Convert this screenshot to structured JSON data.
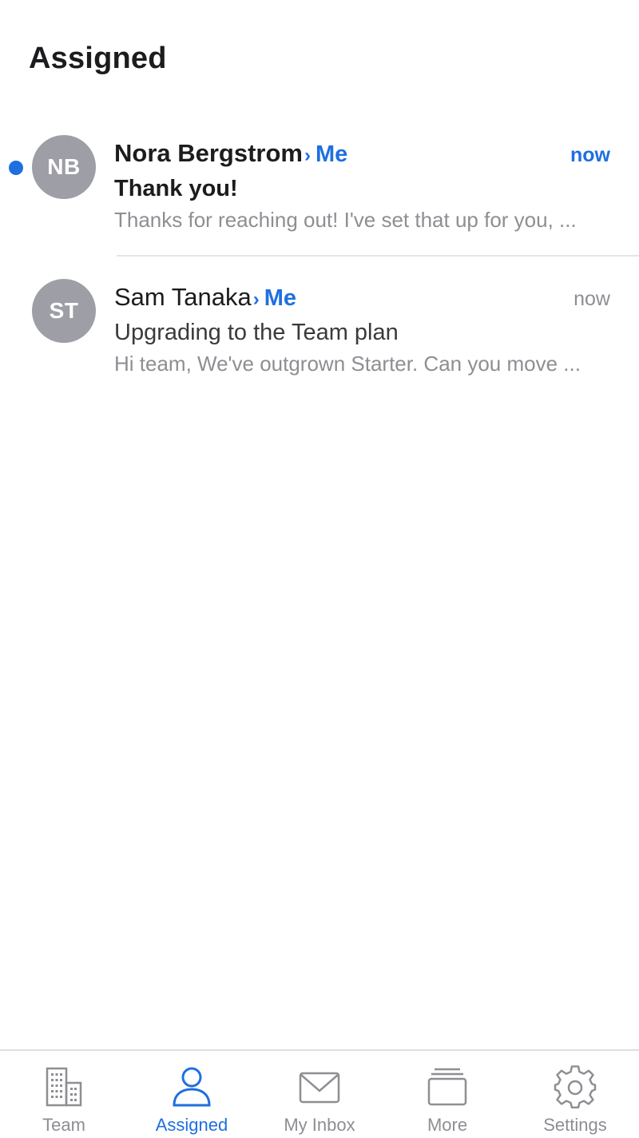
{
  "header": {
    "title": "Assigned"
  },
  "conversations": [
    {
      "initials": "NB",
      "sender": "Nora Bergstrom",
      "arrow": "›",
      "assignee": "Me",
      "time": "now",
      "subject": "Thank you!",
      "preview": "Thanks for reaching out! I've set that up for you, ...",
      "unread": true
    },
    {
      "initials": "ST",
      "sender": "Sam Tanaka",
      "arrow": "›",
      "assignee": "Me",
      "time": "now",
      "subject": "Upgrading to the Team plan",
      "preview": "Hi team, We've outgrown Starter. Can you move ...",
      "unread": false
    }
  ],
  "tabbar": {
    "active": "Assigned",
    "tabs": [
      {
        "label": "Team",
        "icon": "building-icon"
      },
      {
        "label": "Assigned",
        "icon": "person-icon"
      },
      {
        "label": "My Inbox",
        "icon": "envelope-icon"
      },
      {
        "label": "More",
        "icon": "stack-icon"
      },
      {
        "label": "Settings",
        "icon": "gear-icon"
      }
    ]
  },
  "colors": {
    "accent": "#1f6fe0",
    "avatar": "#9e9ea6",
    "muted": "#8e8e93",
    "divider": "#e5e5ea"
  }
}
